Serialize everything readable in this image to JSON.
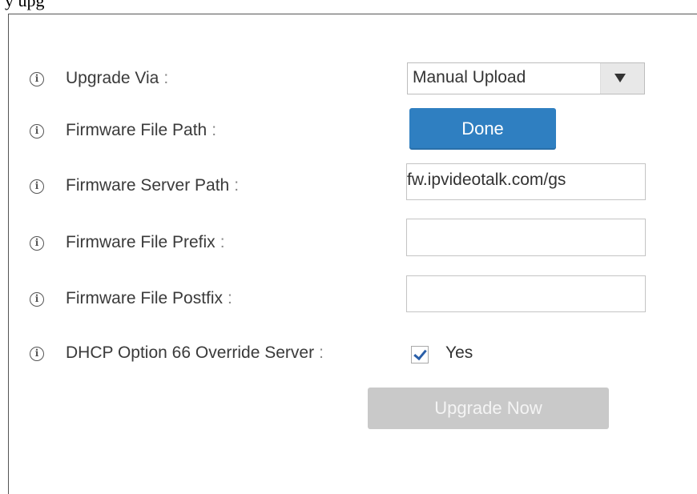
{
  "caption": "y        upg",
  "fields": {
    "upgrade_via": {
      "label": "Upgrade Via",
      "colon": ":",
      "selected": "Manual Upload"
    },
    "firmware_file_path": {
      "label": "Firmware File Path",
      "colon": ":",
      "button_label": "Done"
    },
    "firmware_server_path": {
      "label": "Firmware Server Path",
      "colon": ":",
      "value": "fw.ipvideotalk.com/gs"
    },
    "firmware_file_prefix": {
      "label": "Firmware File Prefix",
      "colon": ":",
      "value": ""
    },
    "firmware_file_postfix": {
      "label": "Firmware File Postfix",
      "colon": ":",
      "value": ""
    },
    "dhcp_option_66": {
      "label": "DHCP Option 66 Override Server",
      "colon": ":",
      "checked": true,
      "checkbox_label": "Yes"
    }
  },
  "actions": {
    "upgrade_now_label": "Upgrade Now",
    "upgrade_now_enabled": false
  },
  "icons": {
    "info": "info-icon",
    "dropdown": "chevron-down-icon",
    "check": "checkmark-icon"
  },
  "colors": {
    "primary_button": "#2f7fc1",
    "disabled_button": "#c9c9c9",
    "checkmark": "#2a5fa8"
  }
}
